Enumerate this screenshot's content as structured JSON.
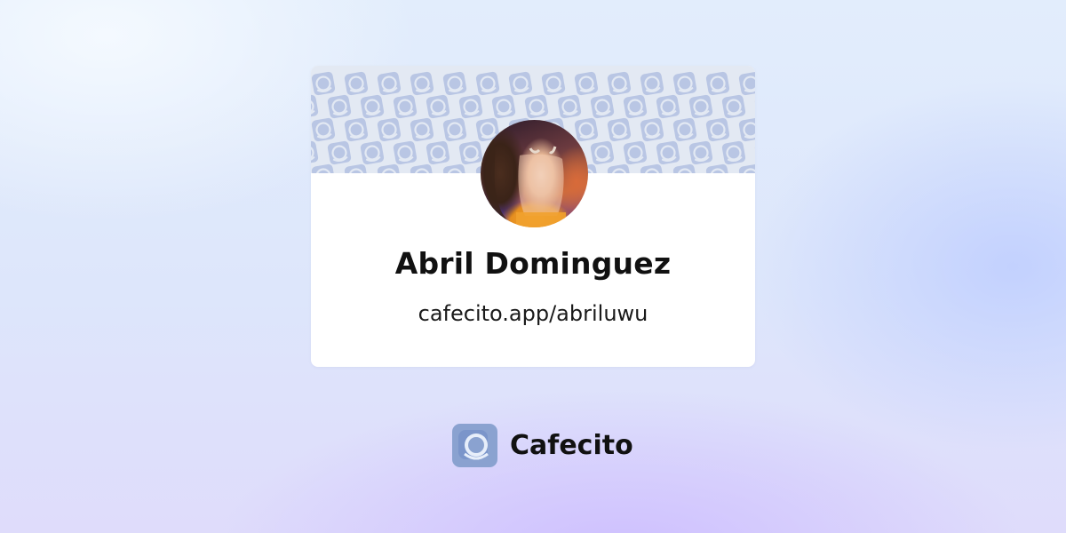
{
  "profile": {
    "name": "Abril Dominguez",
    "url": "cafecito.app/abriluwu"
  },
  "footer": {
    "brand_name": "Cafecito"
  },
  "icons": {
    "banner_pattern": "coffee-cup-icon",
    "brand_logo": "cafecito-cup-logo-icon"
  },
  "colors": {
    "banner_background": "#e3e9f3",
    "pattern_icon": "#b9c6e4",
    "brand_logo_tile": "#8aa2d0",
    "text": "#111111"
  }
}
